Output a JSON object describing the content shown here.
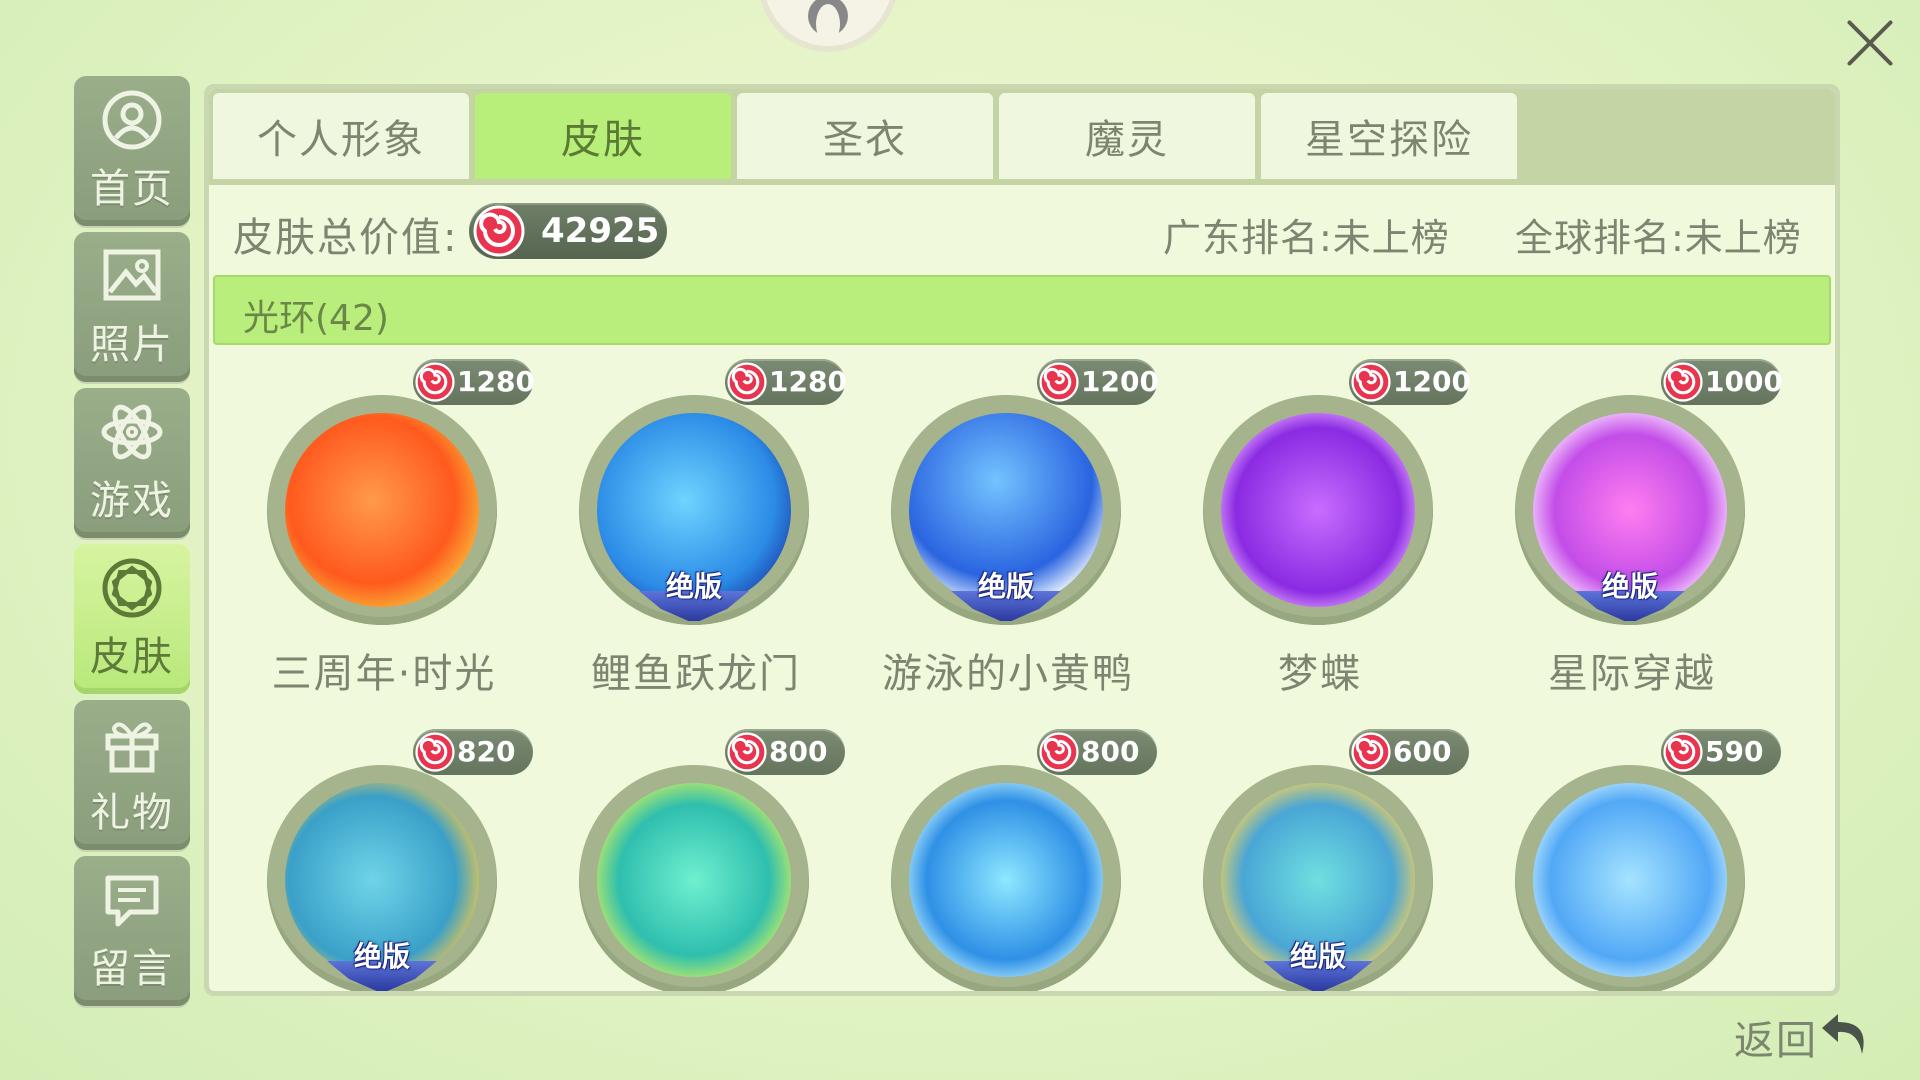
{
  "window": {
    "close_label": "close"
  },
  "sidebar": {
    "items": [
      {
        "label": "首页",
        "icon": "user-icon"
      },
      {
        "label": "照片",
        "icon": "image-icon"
      },
      {
        "label": "游戏",
        "icon": "atom-icon"
      },
      {
        "label": "皮肤",
        "icon": "ball-icon",
        "active": true
      },
      {
        "label": "礼物",
        "icon": "gift-icon"
      },
      {
        "label": "留言",
        "icon": "message-icon"
      }
    ]
  },
  "tabs": [
    {
      "label": "个人形象"
    },
    {
      "label": "皮肤",
      "active": true
    },
    {
      "label": "圣衣"
    },
    {
      "label": "魔灵"
    },
    {
      "label": "星空探险"
    }
  ],
  "summary": {
    "total_label": "皮肤总价值:",
    "total_value": "42925",
    "regional_rank": "广东排名:未上榜",
    "global_rank": "全球排名:未上榜"
  },
  "section": {
    "title": "光环(42)"
  },
  "items": [
    {
      "name": "三周年·时光",
      "price": "1280",
      "badge": ""
    },
    {
      "name": "鲤鱼跃龙门",
      "price": "1280",
      "badge": "绝版"
    },
    {
      "name": "游泳的小黄鸭",
      "price": "1200",
      "badge": "绝版"
    },
    {
      "name": "梦蝶",
      "price": "1200",
      "badge": ""
    },
    {
      "name": "星际穿越",
      "price": "1000",
      "badge": "绝版"
    },
    {
      "name": "",
      "price": "820",
      "badge": "绝版"
    },
    {
      "name": "",
      "price": "800",
      "badge": ""
    },
    {
      "name": "",
      "price": "800",
      "badge": ""
    },
    {
      "name": "",
      "price": "600",
      "badge": "绝版"
    },
    {
      "name": "",
      "price": "590",
      "badge": ""
    }
  ],
  "footer": {
    "back_label": "返回"
  },
  "colors": {
    "accent_green": "#b8ee7a",
    "coin_red": "#e8344e",
    "badge_blue": "#3a4bc0"
  }
}
